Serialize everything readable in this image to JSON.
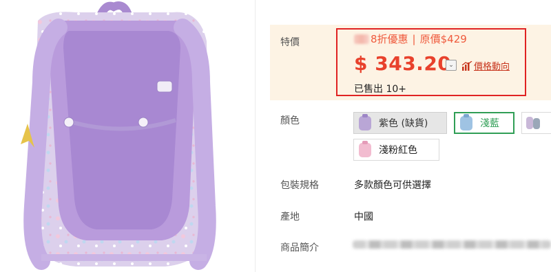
{
  "product_image": {
    "alt": "purple backpack"
  },
  "price_section": {
    "label": "特價",
    "promo_text": "8折優惠",
    "separator": "|",
    "original_price": "原價$429",
    "price": "$ 343.20",
    "dropdown_glyph": "⌄",
    "trend_label": "價格動向",
    "sold": "已售出 10+"
  },
  "color_section": {
    "label": "顏色",
    "options": [
      {
        "label": "紫色 (缺貨)",
        "state": "disabled",
        "thumb_color": "#b9a6d6"
      },
      {
        "label": "淺藍",
        "state": "selected",
        "thumb_color": "#9fc3e3"
      },
      {
        "label": "",
        "state": "normal",
        "thumb_color": "#c9b8d8"
      },
      {
        "label": "淺粉紅色",
        "state": "normal",
        "thumb_color": "#f2bcd0"
      }
    ]
  },
  "packaging": {
    "label": "包裝規格",
    "value": "多款顏色可供選擇"
  },
  "origin": {
    "label": "產地",
    "value": "中國"
  },
  "intro": {
    "label": "商品簡介"
  },
  "colors": {
    "accent_red": "#e8412c",
    "highlight_border": "#e02222",
    "selected_green": "#2f9e55",
    "panel_bg": "#fdf3e4"
  }
}
